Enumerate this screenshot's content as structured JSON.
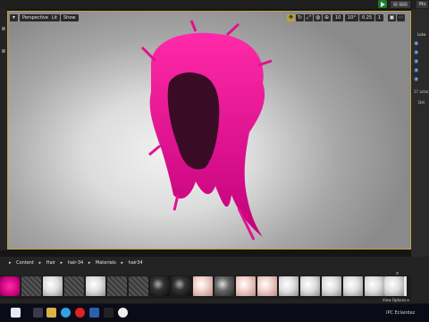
{
  "topbar": {
    "btn1": "▤ ▤▤",
    "btn2": "Mo"
  },
  "viewport": {
    "view_mode": "Perspective",
    "lit_mode": "Lit",
    "show_label": "Show",
    "grid_value": "10",
    "rot_value": "10°",
    "scale_value": "0.25",
    "cam_speed": "1"
  },
  "right_panel": {
    "label1": "Loka",
    "count": "17 actor",
    "label2": "Det"
  },
  "content_browser": {
    "path": [
      "Content",
      "Hair",
      "hair-34",
      "Materials",
      "hair34"
    ],
    "view_options": "View Options ▾"
  },
  "taskbar": {
    "tray_text": "IPC  Eclairdez"
  },
  "colors": {
    "accent_gold": "#b8a13c",
    "hair_magenta": "#e0128f",
    "play_green": "#1f7a2e"
  }
}
